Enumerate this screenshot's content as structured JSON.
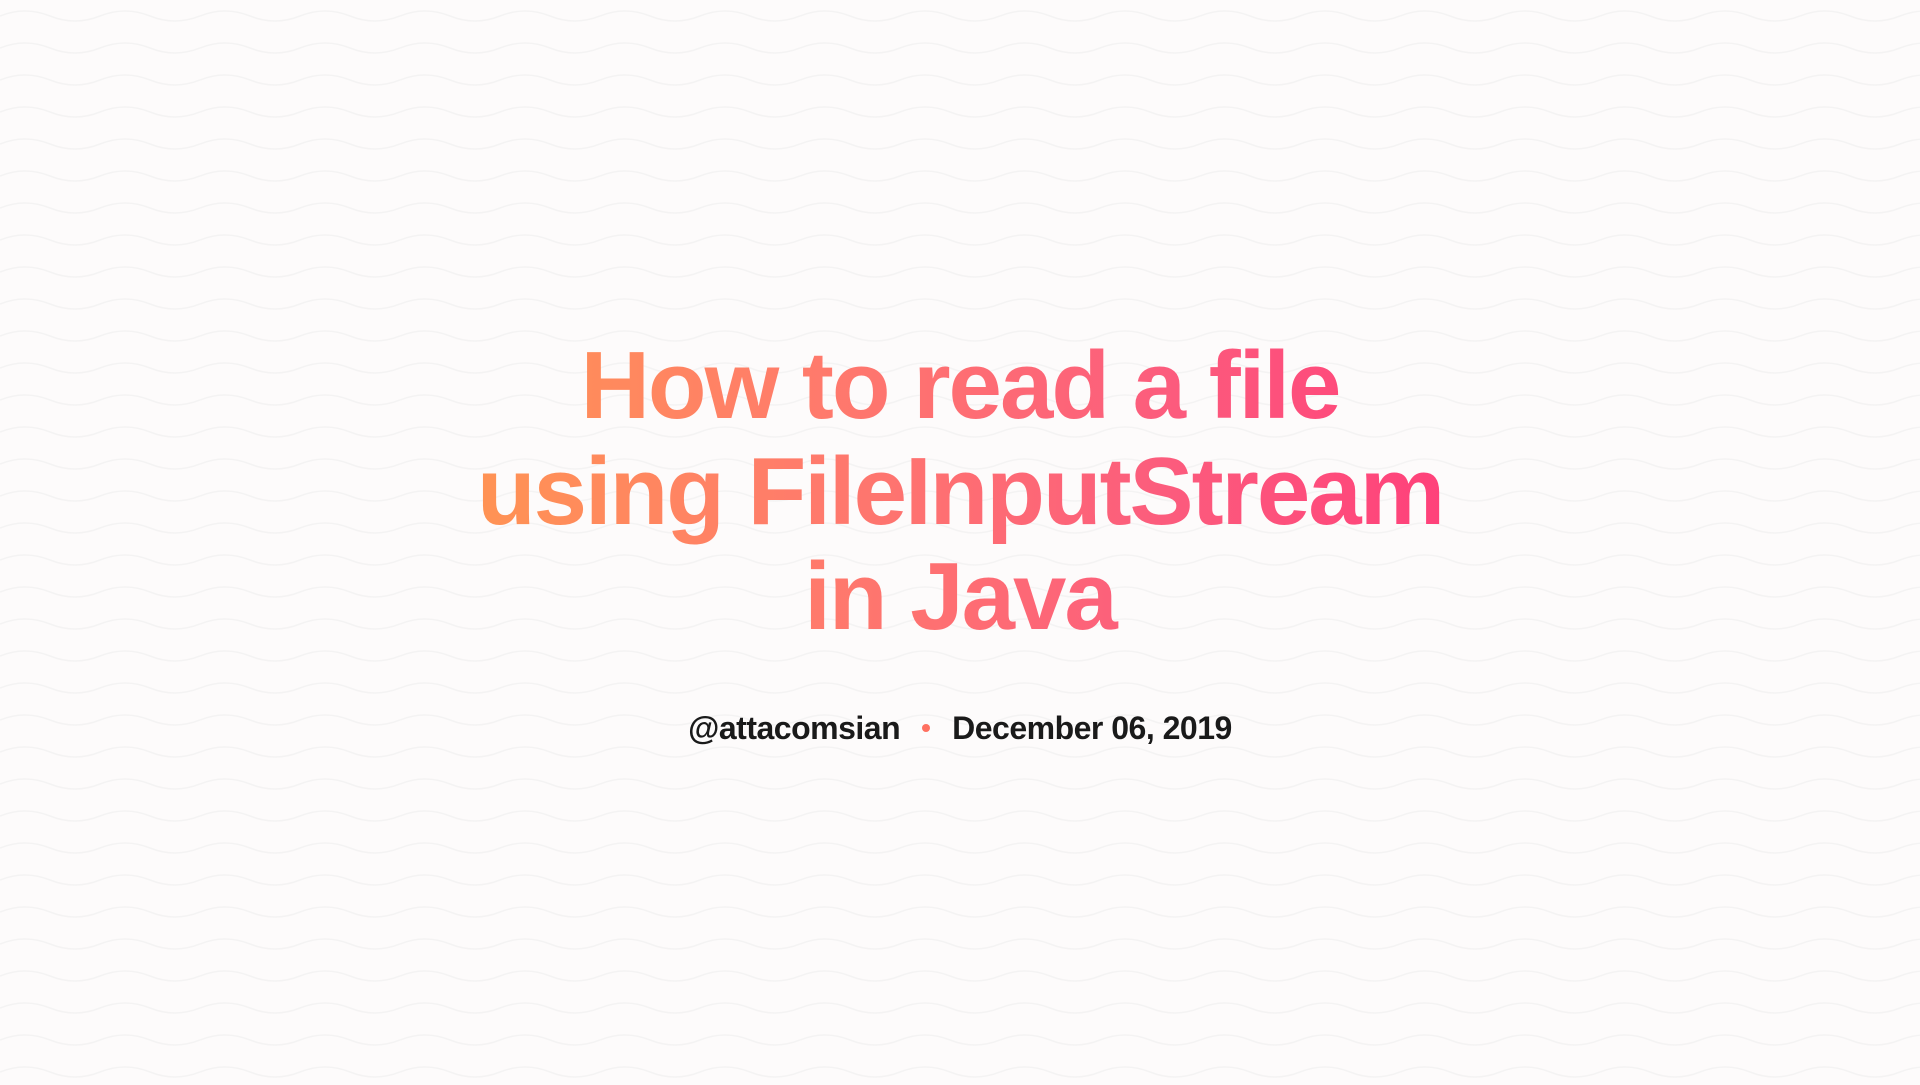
{
  "title": "How to read a file using FileInputStream in Java",
  "author": "@attacomsian",
  "date": "December 06, 2019",
  "colors": {
    "gradient_start": "#FF9552",
    "gradient_end": "#FF3E7A",
    "dot": "#FF7060",
    "text_dark": "#1a1a1a",
    "bg": "#fdfbfb",
    "wave_stroke": "#ececec"
  }
}
